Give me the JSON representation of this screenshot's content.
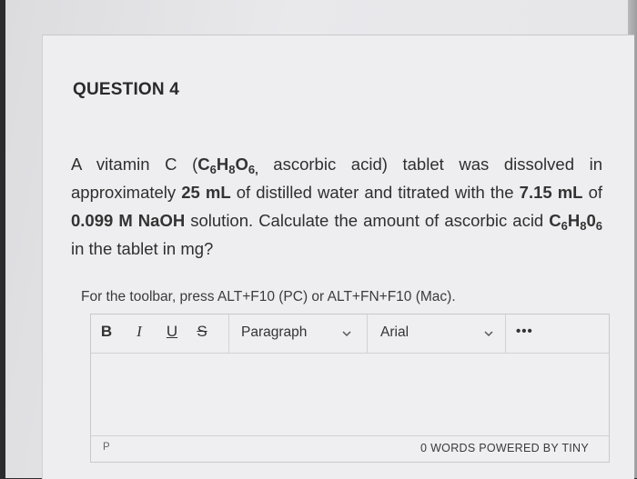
{
  "question": {
    "title": "QUESTION 4",
    "part1": "A vitamin C (",
    "formula_main": "C",
    "formula_s1": "6",
    "formula_h": "H",
    "formula_s2": "8",
    "formula_o": "O",
    "formula_s3": "6,",
    "part2": " ascorbic acid) tablet was dissolved in approximately ",
    "volume_water": "25 mL",
    "part3": " of distilled water and titrated with the ",
    "volume_naoh": "7.15 mL",
    "part4": " of ",
    "concentration": "0.099 M NaOH",
    "part5": " solution. Calculate the amount of ascorbic acid ",
    "f2_c": "C",
    "f2_s1": "6",
    "f2_h": "H",
    "f2_s2": "8",
    "f2_o": "0",
    "f2_s3": "6",
    "part6": " in the tablet in mg?"
  },
  "editor": {
    "hint": "For the toolbar, press ALT+F10 (PC) or ALT+FN+F10 (Mac).",
    "toolbar": {
      "bold": "B",
      "italic": "I",
      "underline": "U",
      "strike": "S",
      "block_format": "Paragraph",
      "font_family": "Arial",
      "more": "•••"
    },
    "status": {
      "path": "P",
      "word_count": "0 WORDS",
      "powered_by": "POWERED BY TINY"
    }
  }
}
